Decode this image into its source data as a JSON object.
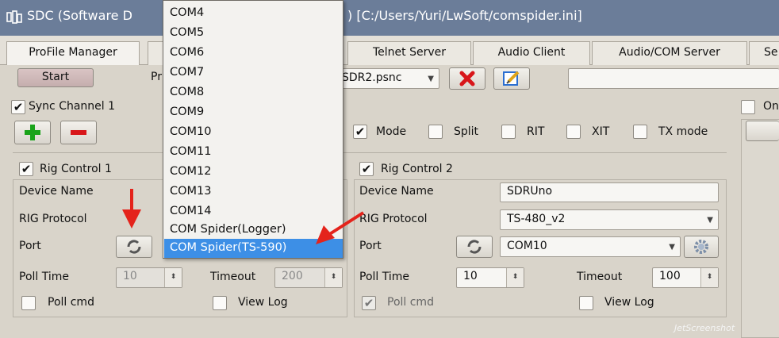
{
  "window": {
    "title_left": "SDC (Software D",
    "title_right": ") [C:/Users/Yuri/LwSoft/comspider.ini]"
  },
  "tabs": [
    {
      "label": "ProFile Manager"
    },
    {
      "label": ""
    },
    {
      "label": "Telnet Server"
    },
    {
      "label": "Audio Client"
    },
    {
      "label": "Audio/COM Server"
    },
    {
      "label": "Se"
    }
  ],
  "toolbar": {
    "start_label": "Start",
    "profile_label_fragment": "Pr",
    "profile_value": "SDR2.psnc",
    "path_value": ""
  },
  "sync_channel": {
    "label": "Sync Channel 1",
    "checked": true
  },
  "on_top": {
    "label": "On"
  },
  "sync_options": [
    {
      "label": "Mode",
      "checked": true
    },
    {
      "label": "Split",
      "checked": false
    },
    {
      "label": "RIT",
      "checked": false
    },
    {
      "label": "XIT",
      "checked": false
    },
    {
      "label": "TX mode",
      "checked": false
    }
  ],
  "rig1": {
    "title": "Rig Control 1",
    "checked": true,
    "device_name_label": "Device Name",
    "rig_protocol_label": "RIG Protocol",
    "port_label": "Port",
    "poll_time_label": "Poll Time",
    "poll_time_value": "10",
    "timeout_label": "Timeout",
    "timeout_value": "200",
    "poll_cmd_label": "Poll cmd",
    "poll_cmd_checked": false,
    "view_log_label": "View Log",
    "view_log_checked": false
  },
  "rig2": {
    "title": "Rig Control 2",
    "checked": true,
    "device_name_label": "Device Name",
    "device_name_value": "SDRUno",
    "rig_protocol_label": "RIG Protocol",
    "rig_protocol_value": "TS-480_v2",
    "port_label": "Port",
    "port_value": "COM10",
    "poll_time_label": "Poll Time",
    "poll_time_value": "10",
    "timeout_label": "Timeout",
    "timeout_value": "100",
    "poll_cmd_label": "Poll cmd",
    "poll_cmd_checked": true,
    "view_log_label": "View Log",
    "view_log_checked": false
  },
  "port_dropdown": {
    "items": [
      "COM4",
      "COM5",
      "COM6",
      "COM7",
      "COM8",
      "COM9",
      "COM10",
      "COM11",
      "COM12",
      "COM13",
      "COM14",
      "COM Spider(Logger)",
      "COM Spider(TS-590)"
    ],
    "selected": "COM Spider(TS-590)"
  },
  "watermark": "JetScreenshot",
  "colors": {
    "titlebar": "#6b7d99",
    "selection": "#3d8fe6",
    "arrow": "#e4231b",
    "add_icon": "#1aa31a",
    "remove_icon": "#d8161a"
  }
}
